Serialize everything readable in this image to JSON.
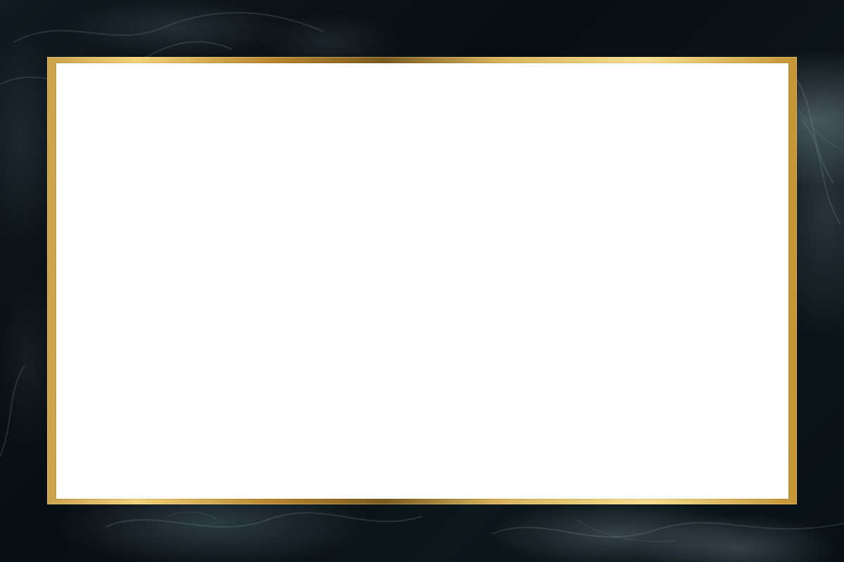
{
  "colors": {
    "background": "#0b1217",
    "frame_gold": "#d9b25a",
    "panel": "#ffffff"
  },
  "content": {}
}
